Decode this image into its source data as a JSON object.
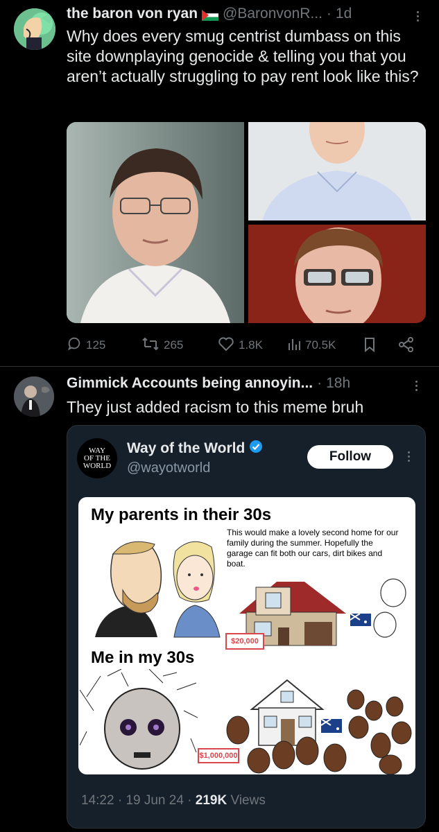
{
  "post1": {
    "display_name": "the baron von ryan",
    "flag_icon": "palestine-flag-icon",
    "handle": "@BaronvonR...",
    "dot": "·",
    "time": "1d",
    "text": "Why does every smug centrist dumbass on this site downplaying genocide & telling you that you aren’t actually struggling to pay rent look like this?",
    "replies": "125",
    "reposts": "265",
    "likes": "1.8K",
    "views": "70.5K"
  },
  "post2": {
    "display_name": "Gimmick Accounts being annoyin...",
    "dot": "·",
    "time": "18h",
    "text": "They just added racism to this meme bruh",
    "quote": {
      "avatar_text": [
        "WAY",
        "OF THE",
        "WORLD"
      ],
      "display_name": "Way of the World",
      "handle": "@wayotworld",
      "follow_label": "Follow",
      "meme": {
        "title_top": "My parents in their 30s",
        "caption": "This would make a lovely second home for our family during the summer. Hopefully the garage can fit both our cars, dirt bikes and boat.",
        "price_top": "$20,000",
        "title_bottom": "Me in my 30s",
        "price_bottom": "$1,000,000"
      },
      "footer_time": "14:22",
      "footer_dot1": "·",
      "footer_date": "19 Jun 24",
      "footer_dot2": "·",
      "footer_views_count": "219K",
      "footer_views_label": "Views"
    }
  },
  "colors": {
    "background": "#000000",
    "text": "#e7e9ea",
    "muted": "#71767b",
    "verified": "#1d9bf0",
    "card": "#15202b"
  }
}
